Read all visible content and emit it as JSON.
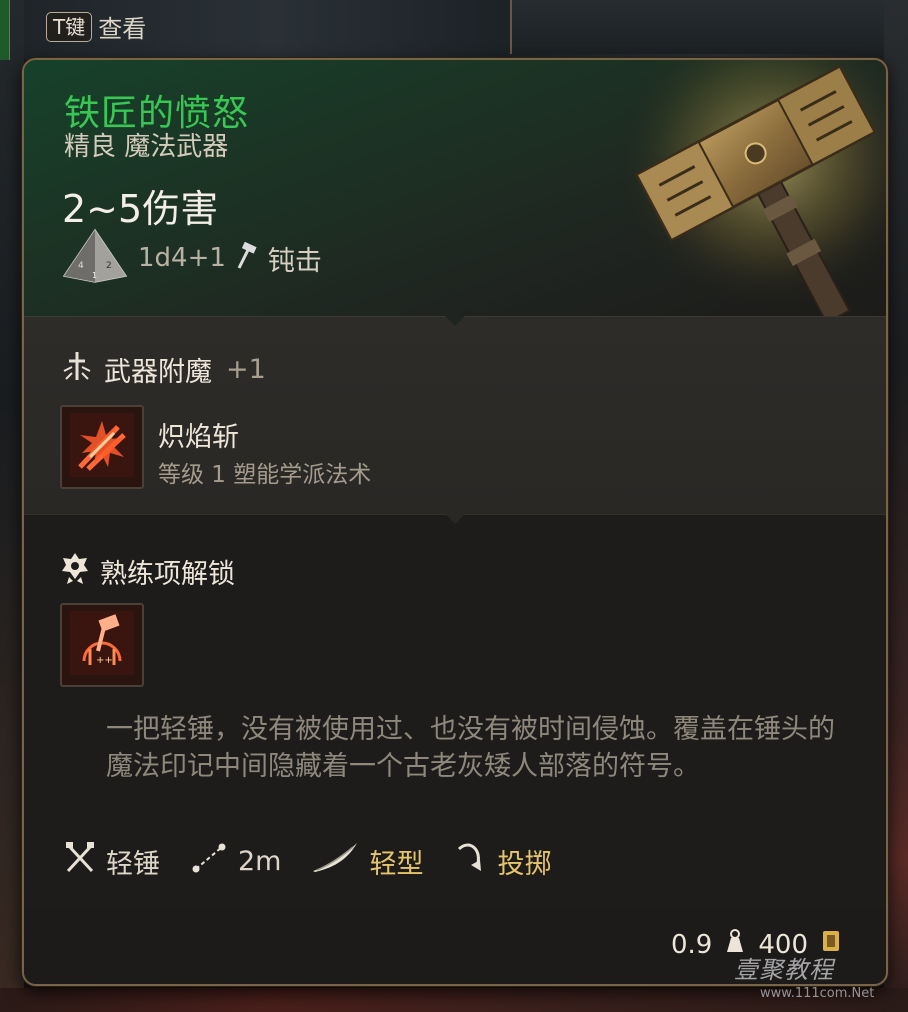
{
  "key_hint": {
    "key": "T键",
    "action": "查看"
  },
  "item": {
    "name": "铁匠的愤怒",
    "type": "精良 魔法武器",
    "damage": "2~5伤害",
    "dice": "1d4+1",
    "damage_type": "钝击",
    "name_color": "#38c654",
    "image_icon": "warhammer-image"
  },
  "enchantment": {
    "title": "武器附魔",
    "bonus": "+1",
    "spell": {
      "name": "炽焰斩",
      "description": "等级 1 塑能学派法术",
      "icon": "flame-slash-icon"
    }
  },
  "proficiency": {
    "title": "熟练项解锁",
    "action_icon": "hammer-action-icon",
    "lore": "一把轻锤，没有被使用过、也没有被时间侵蚀。覆盖在锤头的魔法印记中间隐藏着一个古老灰矮人部落的符号。"
  },
  "properties": [
    {
      "label": "轻锤",
      "icon": "crossed-weapons-icon"
    },
    {
      "label": "2m",
      "icon": "range-icon"
    },
    {
      "label": "轻型",
      "icon": "feather-icon"
    },
    {
      "label": "投掷",
      "icon": "throw-arc-icon"
    }
  ],
  "footer": {
    "weight": "0.9",
    "value": "400"
  },
  "watermark": {
    "text": "壹聚教程",
    "url": "www.111com.Net"
  }
}
